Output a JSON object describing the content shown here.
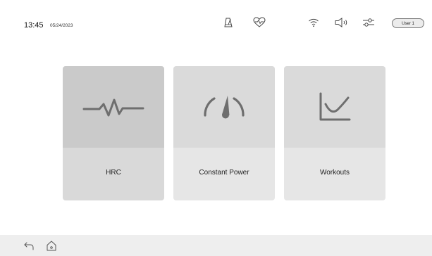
{
  "status_bar": {
    "time": "13:45",
    "date": "05/24/2023",
    "icons": [
      "metronome-icon",
      "heart-rate-icon",
      "wifi-icon",
      "volume-icon",
      "settings-sliders-icon"
    ],
    "user_label": "User 1"
  },
  "tiles": [
    {
      "label": "HRC",
      "icon": "pulse-line-icon",
      "selected": true
    },
    {
      "label": "Constant Power",
      "icon": "gauge-icon",
      "selected": false
    },
    {
      "label": "Workouts",
      "icon": "line-chart-icon",
      "selected": false
    }
  ],
  "bottom_bar": {
    "icons": [
      "back-icon",
      "home-icon"
    ]
  },
  "colors": {
    "background": "#ffffff",
    "tile_selected_top": "#cacaca",
    "tile_selected_bottom": "#d9d9d9",
    "tile_top": "#dadada",
    "tile_bottom": "#e6e6e6",
    "icon_gray": "#6e6e6e",
    "bottom_bar": "#eeeeee"
  }
}
